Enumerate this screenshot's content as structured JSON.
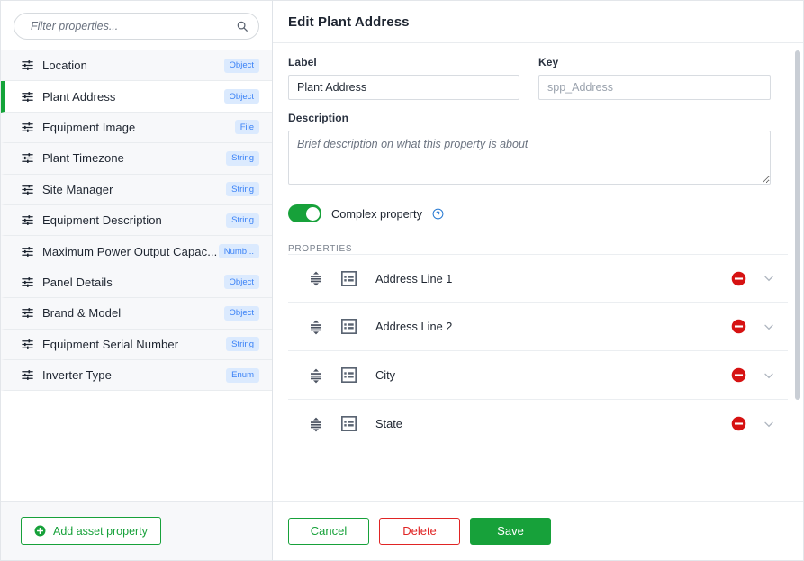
{
  "sidebar": {
    "search": {
      "placeholder": "Filter properties...",
      "value": "",
      "icon": "search-icon"
    },
    "items": [
      {
        "label": "Location",
        "type": "Object",
        "icon": "tune-icon",
        "active": false
      },
      {
        "label": "Plant Address",
        "type": "Object",
        "icon": "tune-icon",
        "active": true
      },
      {
        "label": "Equipment Image",
        "type": "File",
        "icon": "tune-icon",
        "active": false
      },
      {
        "label": "Plant Timezone",
        "type": "String",
        "icon": "tune-icon",
        "active": false
      },
      {
        "label": "Site Manager",
        "type": "String",
        "icon": "tune-icon",
        "active": false
      },
      {
        "label": "Equipment Description",
        "type": "String",
        "icon": "tune-icon",
        "active": false
      },
      {
        "label": "Maximum Power Output Capac...",
        "type": "Numb...",
        "icon": "tune-icon",
        "active": false
      },
      {
        "label": "Panel Details",
        "type": "Object",
        "icon": "tune-icon",
        "active": false
      },
      {
        "label": "Brand & Model",
        "type": "Object",
        "icon": "tune-icon",
        "active": false
      },
      {
        "label": "Equipment Serial Number",
        "type": "String",
        "icon": "tune-icon",
        "active": false
      },
      {
        "label": "Inverter Type",
        "type": "Enum",
        "icon": "tune-icon",
        "active": false
      }
    ],
    "footer": {
      "add_label": "Add asset property",
      "add_icon": "plus-circle-icon"
    }
  },
  "panel": {
    "title": "Edit Plant Address",
    "form": {
      "label_field": {
        "label": "Label",
        "value": "Plant Address",
        "placeholder": ""
      },
      "key_field": {
        "label": "Key",
        "value": "",
        "placeholder": "spp_Address"
      },
      "description_field": {
        "label": "Description",
        "value": "",
        "placeholder": "Brief description on what this property is about"
      },
      "complex_toggle": {
        "label": "Complex property",
        "state": "on",
        "help_icon": "question-circle-icon"
      }
    },
    "properties_section": {
      "heading": "PROPERTIES",
      "rows": [
        {
          "label": "Address Line 1",
          "drag_icon": "drag-handle-icon",
          "type_icon": "form-list-icon",
          "remove_icon": "minus-circle-icon",
          "expand_icon": "chevron-down-icon"
        },
        {
          "label": "Address Line 2",
          "drag_icon": "drag-handle-icon",
          "type_icon": "form-list-icon",
          "remove_icon": "minus-circle-icon",
          "expand_icon": "chevron-down-icon"
        },
        {
          "label": "City",
          "drag_icon": "drag-handle-icon",
          "type_icon": "form-list-icon",
          "remove_icon": "minus-circle-icon",
          "expand_icon": "chevron-down-icon"
        },
        {
          "label": "State",
          "drag_icon": "drag-handle-icon",
          "type_icon": "form-list-icon",
          "remove_icon": "minus-circle-icon",
          "expand_icon": "chevron-down-icon"
        }
      ]
    },
    "footer": {
      "cancel_label": "Cancel",
      "delete_label": "Delete",
      "save_label": "Save"
    }
  },
  "colors": {
    "brand_green": "#17a13a",
    "danger_red": "#e02424",
    "badge_bg": "#dbeafe",
    "badge_text": "#3b82f6",
    "help_blue": "#2b7cd3",
    "row_bg": "#f7f8fa",
    "text_primary": "#1e2530"
  }
}
